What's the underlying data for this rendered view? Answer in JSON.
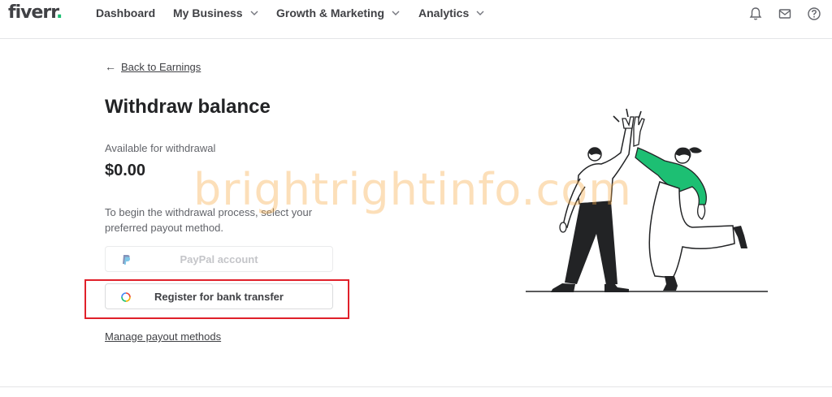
{
  "header": {
    "logo": "fiverr",
    "logo_dot": ".",
    "nav": [
      {
        "label": "Dashboard"
      },
      {
        "label": "My Business"
      },
      {
        "label": "Growth & Marketing"
      },
      {
        "label": "Analytics"
      }
    ]
  },
  "main": {
    "back_link": "Back to Earnings",
    "title": "Withdraw balance",
    "available_label": "Available for withdrawal",
    "amount": "$0.00",
    "description": "To begin the withdrawal process, select your preferred payout method.",
    "paypal_button": "PayPal account",
    "bank_button": "Register for bank transfer",
    "manage_link": "Manage payout methods"
  },
  "watermark": "brightrightinfo.com",
  "colors": {
    "brand_green": "#1dbf73",
    "highlight_red": "#e0202a",
    "paypal_blue": "#253b80"
  }
}
